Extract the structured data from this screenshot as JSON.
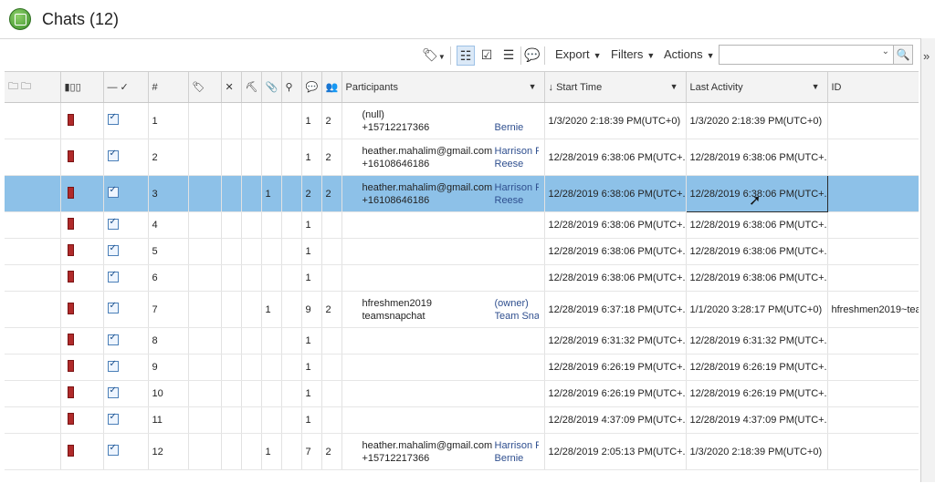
{
  "window": {
    "title": "Chats (12)"
  },
  "toolbar": {
    "export_label": "Export",
    "filters_label": "Filters",
    "actions_label": "Actions",
    "search_placeholder": "",
    "icons": [
      "tag-filter-icon",
      "list-view-icon",
      "checklist-view-icon",
      "numbered-list-icon",
      "chat-bubble-icon",
      "search-icon"
    ]
  },
  "table": {
    "headers": {
      "num": "#",
      "participants": "Participants",
      "start_time": "Start Time",
      "last_activity": "Last Activity",
      "id": "ID"
    },
    "rows": [
      {
        "num": "1",
        "attachments": "",
        "messages": "1",
        "people": "2",
        "participants": [
          [
            "(null)",
            ""
          ],
          [
            "+15712217366",
            "Bernie"
          ]
        ],
        "start": "1/3/2020 2:18:39 PM(UTC+0)",
        "last": "1/3/2020 2:18:39 PM(UTC+0)",
        "id": ""
      },
      {
        "num": "2",
        "attachments": "",
        "messages": "1",
        "people": "2",
        "participants": [
          [
            "heather.mahalim@gmail.com",
            "Harrison F"
          ],
          [
            "+16108646186",
            "Reese"
          ]
        ],
        "start": "12/28/2019 6:38:06 PM(UTC+...",
        "last": "12/28/2019 6:38:06 PM(UTC+...",
        "id": ""
      },
      {
        "num": "3",
        "attachments": "1",
        "messages": "2",
        "people": "2",
        "participants": [
          [
            "heather.mahalim@gmail.com",
            "Harrison F"
          ],
          [
            "+16108646186",
            "Reese"
          ]
        ],
        "start": "12/28/2019 6:38:06 PM(UTC+...",
        "last": "12/28/2019 6:38:06 PM(UTC+...",
        "id": ""
      },
      {
        "num": "4",
        "attachments": "",
        "messages": "1",
        "people": "",
        "participants": [],
        "start": "12/28/2019 6:38:06 PM(UTC+...",
        "last": "12/28/2019 6:38:06 PM(UTC+...",
        "id": ""
      },
      {
        "num": "5",
        "attachments": "",
        "messages": "1",
        "people": "",
        "participants": [],
        "start": "12/28/2019 6:38:06 PM(UTC+...",
        "last": "12/28/2019 6:38:06 PM(UTC+...",
        "id": ""
      },
      {
        "num": "6",
        "attachments": "",
        "messages": "1",
        "people": "",
        "participants": [],
        "start": "12/28/2019 6:38:06 PM(UTC+...",
        "last": "12/28/2019 6:38:06 PM(UTC+...",
        "id": ""
      },
      {
        "num": "7",
        "attachments": "1",
        "messages": "9",
        "people": "2",
        "participants": [
          [
            "hfreshmen2019",
            "(owner)"
          ],
          [
            "teamsnapchat",
            "Team Snapchat"
          ]
        ],
        "start": "12/28/2019 6:37:18 PM(UTC+...",
        "last": "1/1/2020 3:28:17 PM(UTC+0)",
        "id": "hfreshmen2019~tea"
      },
      {
        "num": "8",
        "attachments": "",
        "messages": "1",
        "people": "",
        "participants": [],
        "start": "12/28/2019 6:31:32 PM(UTC+...",
        "last": "12/28/2019 6:31:32 PM(UTC+...",
        "id": ""
      },
      {
        "num": "9",
        "attachments": "",
        "messages": "1",
        "people": "",
        "participants": [],
        "start": "12/28/2019 6:26:19 PM(UTC+...",
        "last": "12/28/2019 6:26:19 PM(UTC+...",
        "id": ""
      },
      {
        "num": "10",
        "attachments": "",
        "messages": "1",
        "people": "",
        "participants": [],
        "start": "12/28/2019 6:26:19 PM(UTC+...",
        "last": "12/28/2019 6:26:19 PM(UTC+...",
        "id": ""
      },
      {
        "num": "11",
        "attachments": "",
        "messages": "1",
        "people": "",
        "participants": [],
        "start": "12/28/2019 4:37:09 PM(UTC+...",
        "last": "12/28/2019 4:37:09 PM(UTC+...",
        "id": ""
      },
      {
        "num": "12",
        "attachments": "1",
        "messages": "7",
        "people": "2",
        "participants": [
          [
            "heather.mahalim@gmail.com",
            "Harrison F"
          ],
          [
            "+15712217366",
            "Bernie"
          ]
        ],
        "start": "12/28/2019 2:05:13 PM(UTC+...",
        "last": "1/3/2020 2:18:39 PM(UTC+0)",
        "id": ""
      }
    ],
    "selected_row": "3"
  },
  "colors": {
    "selection": "#8dc1e8",
    "tag_red": "#b02a2a",
    "header_bg": "#f3f3f3"
  }
}
